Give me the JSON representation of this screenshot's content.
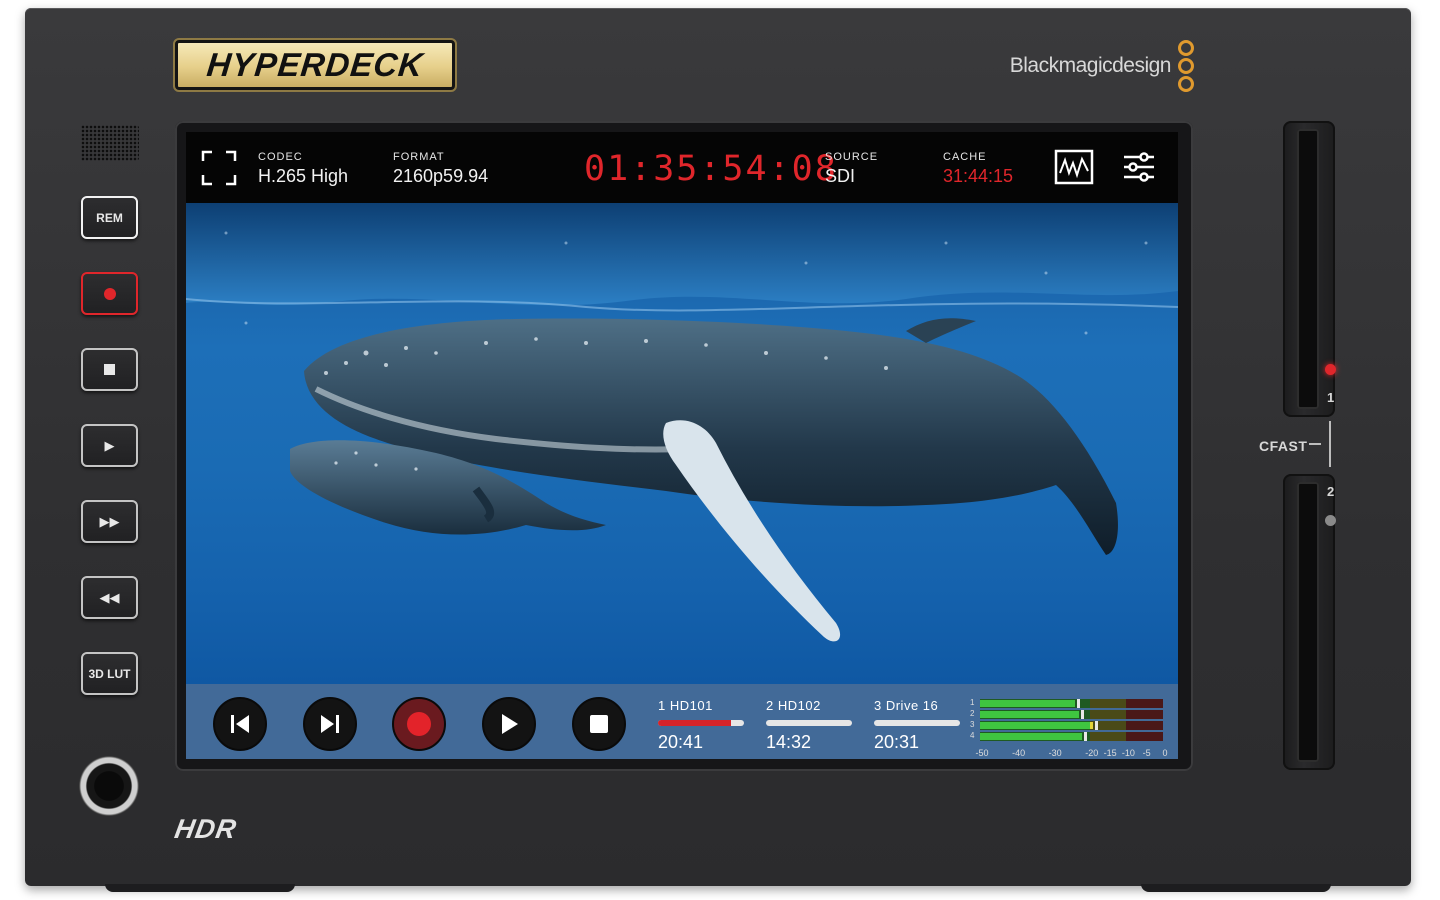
{
  "device": {
    "brand_logo": "HYPERDECK",
    "maker_logo": "Blackmagicdesign",
    "hdr_logo": "HDR",
    "colors": {
      "accent_red": "#e0262b",
      "logo_gold": "#e6cf8a",
      "bmd_orange": "#e09a2e"
    }
  },
  "buttons": {
    "rem": "REM",
    "record": "record-icon",
    "stop": "stop-icon",
    "play": "play-icon",
    "fast_forward": "fast-forward-icon",
    "rewind": "rewind-icon",
    "lut": "3D LUT"
  },
  "screen": {
    "topbar": {
      "codec_label": "CODEC",
      "codec_value": "H.265 High",
      "format_label": "FORMAT",
      "format_value": "2160p59.94",
      "timecode": "01:35:54:08",
      "source_label": "SOURCE",
      "source_value": "SDI",
      "cache_label": "CACHE",
      "cache_value": "31:44:15",
      "icons": [
        "fullscreen-icon",
        "scope-icon",
        "settings-sliders-icon"
      ]
    },
    "transport": [
      "skip-back-icon",
      "skip-forward-icon",
      "record-icon",
      "play-icon",
      "stop-icon"
    ],
    "slots": [
      {
        "name": "1  HD101",
        "time": "20:41",
        "fill": 0.85,
        "active": true
      },
      {
        "name": "2  HD102",
        "time": "14:32",
        "fill": 0.0,
        "active": false
      },
      {
        "name": "3  Drive 16",
        "time": "20:31",
        "fill": 0.0,
        "active": false
      }
    ],
    "audio_meters": {
      "channels": [
        "1",
        "2",
        "3",
        "4"
      ],
      "levels_db": [
        -24,
        -23,
        -19,
        -22
      ],
      "scale": [
        "-50",
        "-40",
        "-30",
        "-20",
        "-15",
        "-10",
        "-5",
        "0"
      ]
    }
  },
  "cfast": {
    "label": "CFAST",
    "slot1_number": "1",
    "slot2_number": "2",
    "slot1_led": "#e0262b",
    "slot2_led": "#8a8a8a"
  }
}
